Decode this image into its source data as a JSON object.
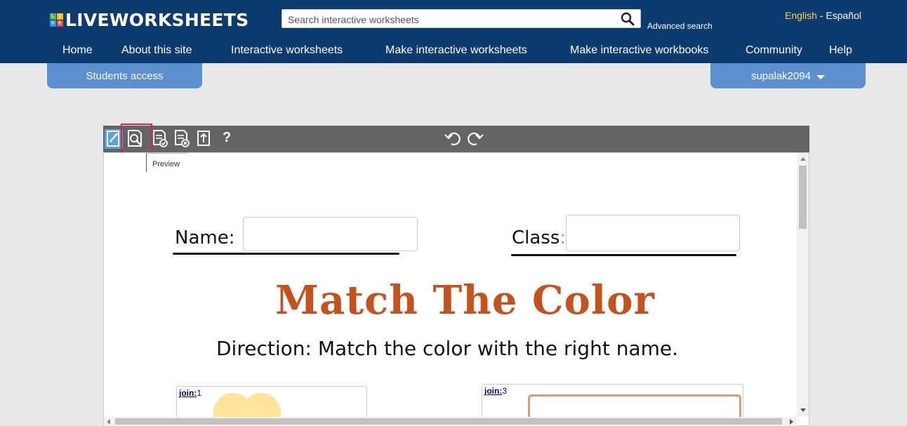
{
  "header": {
    "logo_text": "LIVEWORKSHEETS",
    "logo_tiles": [
      {
        "letter": "L",
        "color": "#4caf50"
      },
      {
        "letter": "I",
        "color": "#ffc107"
      },
      {
        "letter": "V",
        "color": "#2196f3"
      },
      {
        "letter": "E",
        "color": "#f44336"
      }
    ],
    "search_placeholder": "Search interactive worksheets",
    "advanced_search": "Advanced search",
    "lang_english": "English",
    "lang_sep": " - ",
    "lang_spanish": "Español"
  },
  "nav": {
    "items": [
      "Home",
      "About this site",
      "Interactive worksheets",
      "Make interactive worksheets",
      "Make interactive workbooks",
      "Community",
      "Help"
    ]
  },
  "tabs": {
    "students_access": "Students access",
    "user": "supalak2094"
  },
  "toolbar": {
    "question_mark": "?",
    "tooltip": "Preview",
    "icons": [
      "edit-icon",
      "preview-icon",
      "check-answers-icon",
      "clear-answers-icon",
      "upload-icon",
      "help-icon",
      "undo-icon",
      "redo-icon"
    ]
  },
  "worksheet": {
    "name_label": "Name:",
    "class_label": "Class",
    "class_colon": ":",
    "title": "Match The Color",
    "direction": "Direction: Match the color with the right name.",
    "join_prefix": "join:",
    "join_1": "1",
    "join_3": "3"
  },
  "colors": {
    "header_bg": "#0c3b70",
    "tab_bg": "#5b8fcf",
    "toolbar_bg": "#646464",
    "title_color": "#c4521c",
    "highlight": "#e0204a",
    "english_color": "#ffd24a"
  }
}
